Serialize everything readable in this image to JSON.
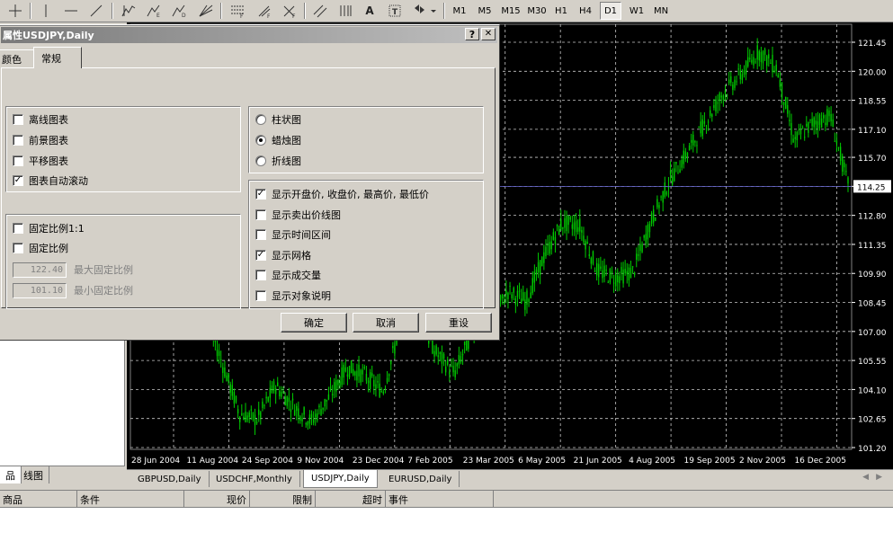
{
  "toolbar": {
    "text_tool": "A",
    "timeframes": [
      "M1",
      "M5",
      "M15",
      "M30",
      "H1",
      "H4",
      "D1",
      "W1",
      "MN"
    ],
    "active_timeframe": "D1"
  },
  "dialog": {
    "title": "属性USDJPY,Daily",
    "help_btn": "?",
    "close_btn": "✕",
    "tabs": [
      "颜色",
      "常规"
    ],
    "active_tab": "常规",
    "display_group": [
      {
        "label": "离线图表",
        "checked": false
      },
      {
        "label": "前景图表",
        "checked": false
      },
      {
        "label": "平移图表",
        "checked": false
      },
      {
        "label": "图表自动滚动",
        "checked": true
      }
    ],
    "scale_group": [
      {
        "label": "固定比例1:1",
        "checked": false
      },
      {
        "label": "固定比例",
        "checked": false
      }
    ],
    "fixed_max": {
      "value": "122.40",
      "label": "最大固定比例"
    },
    "fixed_min": {
      "value": "101.10",
      "label": "最小固定比例"
    },
    "chart_types": [
      {
        "label": "柱状图",
        "selected": false
      },
      {
        "label": "蜡烛图",
        "selected": true
      },
      {
        "label": "折线图",
        "selected": false
      }
    ],
    "show_options": [
      {
        "label": "显示开盘价, 收盘价, 最高价, 最低价",
        "checked": true
      },
      {
        "label": "显示卖出价线图",
        "checked": false
      },
      {
        "label": "显示时间区间",
        "checked": false
      },
      {
        "label": "显示网格",
        "checked": true
      },
      {
        "label": "显示成交量",
        "checked": false
      },
      {
        "label": "显示对象说明",
        "checked": false
      }
    ],
    "buttons": {
      "ok": "确定",
      "cancel": "取消",
      "reset": "重设"
    }
  },
  "chart_data": {
    "type": "candlestick",
    "symbol": "USDJPY",
    "period": "Daily",
    "x_tick_labels": [
      "28 Jun 2004",
      "11 Aug 2004",
      "24 Sep 2004",
      "9 Nov 2004",
      "23 Dec 2004",
      "7 Feb 2005",
      "23 Mar 2005",
      "6 May 2005",
      "21 Jun 2005",
      "4 Aug 2005",
      "19 Sep 2005",
      "2 Nov 2005",
      "16 Dec 2005"
    ],
    "y_tick_labels": [
      "121.45",
      "120.00",
      "118.55",
      "117.10",
      "115.70",
      "114.25",
      "112.80",
      "111.35",
      "109.90",
      "108.45",
      "107.00",
      "105.55",
      "104.10",
      "102.65",
      "101.20"
    ],
    "ylim": [
      101.2,
      121.45
    ],
    "current_price": "114.25",
    "grid": true,
    "close_series": [
      {
        "x": "28 Jun 2004",
        "y": 109.3
      },
      {
        "x": "11 Aug 2004",
        "y": 110.9
      },
      {
        "x": "24 Sep 2004",
        "y": 110.3
      },
      {
        "x": "1 Oct 2004",
        "y": 110.2
      },
      {
        "x": "15 Oct 2004",
        "y": 108.1
      },
      {
        "x": "2 Nov 2004",
        "y": 105.5
      },
      {
        "x": "18 Nov 2004",
        "y": 102.9
      },
      {
        "x": "1 Dec 2004",
        "y": 102.6
      },
      {
        "x": "14 Dec 2004",
        "y": 104.3
      },
      {
        "x": "30 Dec 2004",
        "y": 103.3
      },
      {
        "x": "14 Jan 2005",
        "y": 102.5
      },
      {
        "x": "24 Jan 2005",
        "y": 103.7
      },
      {
        "x": "7 Feb 2005",
        "y": 105.2
      },
      {
        "x": "22 Feb 2005",
        "y": 104.8
      },
      {
        "x": "7 Mar 2005",
        "y": 104.0
      },
      {
        "x": "23 Mar 2005",
        "y": 107.3
      },
      {
        "x": "1 Apr 2005",
        "y": 107.6
      },
      {
        "x": "15 Apr 2005",
        "y": 105.9
      },
      {
        "x": "6 May 2005",
        "y": 104.9
      },
      {
        "x": "20 May 2005",
        "y": 107.0
      },
      {
        "x": "3 Jun 2005",
        "y": 107.6
      },
      {
        "x": "15 Jun 2005",
        "y": 109.0
      },
      {
        "x": "21 Jun 2005",
        "y": 108.5
      },
      {
        "x": "1 Jul 2005",
        "y": 110.7
      },
      {
        "x": "11 Jul 2005",
        "y": 112.4
      },
      {
        "x": "20 Jul 2005",
        "y": 112.3
      },
      {
        "x": "4 Aug 2005",
        "y": 110.0
      },
      {
        "x": "15 Aug 2005",
        "y": 109.7
      },
      {
        "x": "29 Aug 2005",
        "y": 110.0
      },
      {
        "x": "19 Sep 2005",
        "y": 112.5
      },
      {
        "x": "10 Oct 2005",
        "y": 114.5
      },
      {
        "x": "20 Oct 2005",
        "y": 115.9
      },
      {
        "x": "2 Nov 2005",
        "y": 117.4
      },
      {
        "x": "15 Nov 2005",
        "y": 118.9
      },
      {
        "x": "28 Nov 2005",
        "y": 119.8
      },
      {
        "x": "5 Dec 2005",
        "y": 121.0
      },
      {
        "x": "9 Dec 2005",
        "y": 120.2
      },
      {
        "x": "16 Dec 2005",
        "y": 116.5
      },
      {
        "x": "21 Dec 2005",
        "y": 117.4
      },
      {
        "x": "28 Dec 2005",
        "y": 117.8
      },
      {
        "x": "3 Jan 2006",
        "y": 114.3
      }
    ],
    "colors": {
      "background": "#000000",
      "candles": "#00cc00",
      "grid": "#c8c8c8",
      "axis_text": "#ffffff"
    }
  },
  "chart_tabs": [
    "GBPUSD,Daily",
    "USDCHF,Monthly",
    "USDJPY,Daily",
    "EURUSD,Daily"
  ],
  "active_chart_tab": "USDJPY,Daily",
  "navigator_tabs": [
    "品",
    "线图"
  ],
  "terminal_columns": [
    "商品",
    "条件",
    "现价",
    "限制",
    "超时",
    "事件"
  ]
}
